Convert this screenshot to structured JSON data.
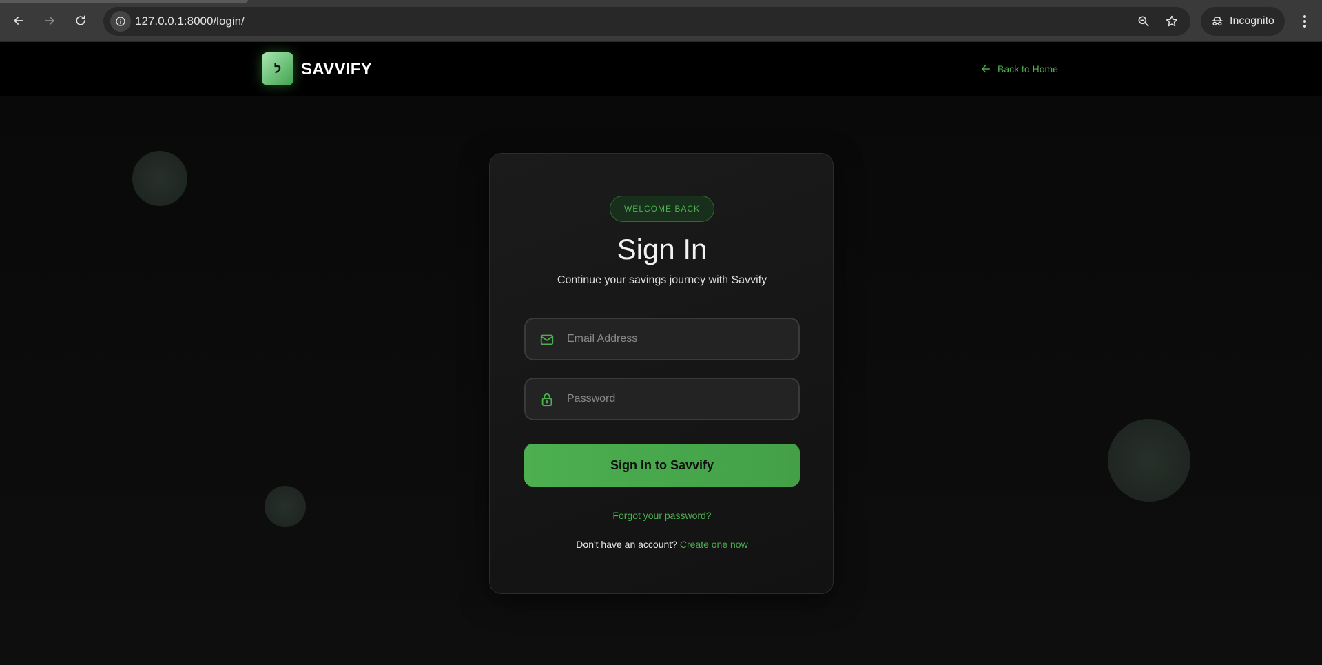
{
  "browser": {
    "url": "127.0.0.1:8000/login/",
    "incognito_label": "Incognito",
    "icons": [
      "back-icon",
      "forward-icon",
      "reload-icon",
      "site-info-icon",
      "zoom-icon",
      "bookmark-star-icon",
      "incognito-icon",
      "more-menu-icon"
    ]
  },
  "header": {
    "logo_glyph": "ל",
    "brand": "SAVVIFY",
    "back_link": "Back to Home"
  },
  "login": {
    "badge": "WELCOME BACK",
    "title": "Sign In",
    "subtitle": "Continue your savings journey with Savvify",
    "email": {
      "placeholder": "Email Address",
      "value": ""
    },
    "password": {
      "placeholder": "Password",
      "value": ""
    },
    "submit_label": "Sign In to Savvify",
    "forgot_label": "Forgot your password?",
    "signup_prompt": "Don't have an account?",
    "signup_link": "Create one now"
  },
  "colors": {
    "accent": "#4caf50",
    "page_bg": "#0b0b0b",
    "card_bg": "#161616"
  }
}
